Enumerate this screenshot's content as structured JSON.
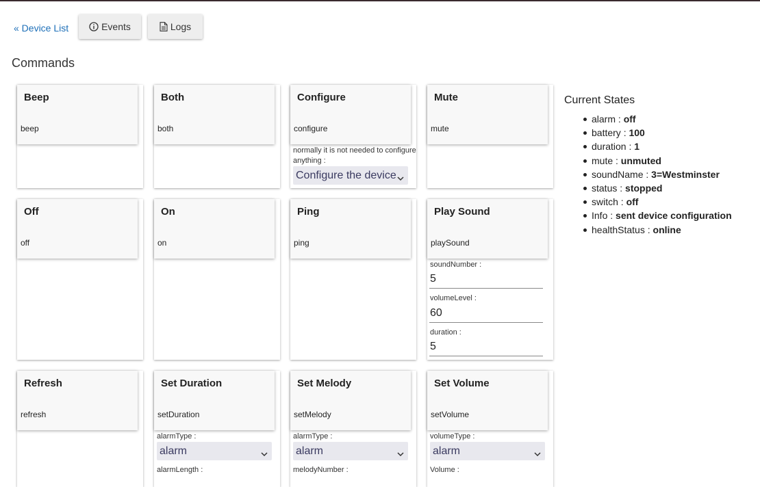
{
  "nav": {
    "back_link": "« Device List",
    "events_label": "Events",
    "logs_label": "Logs"
  },
  "commands_title": "Commands",
  "commands": {
    "beep": {
      "title": "Beep",
      "sub": "beep"
    },
    "both": {
      "title": "Both",
      "sub": "both"
    },
    "configure": {
      "title": "Configure",
      "sub": "configure",
      "param_label": "normally it is not needed to configure anything :",
      "param_value": "Configure the device"
    },
    "mute": {
      "title": "Mute",
      "sub": "mute"
    },
    "off": {
      "title": "Off",
      "sub": "off"
    },
    "on": {
      "title": "On",
      "sub": "on"
    },
    "ping": {
      "title": "Ping",
      "sub": "ping"
    },
    "play_sound": {
      "title": "Play Sound",
      "sub": "playSound",
      "params": [
        {
          "label": "soundNumber :",
          "value": "5"
        },
        {
          "label": "volumeLevel :",
          "value": "60"
        },
        {
          "label": "duration :",
          "value": "5"
        }
      ]
    },
    "refresh": {
      "title": "Refresh",
      "sub": "refresh"
    },
    "set_duration": {
      "title": "Set Duration",
      "sub": "setDuration",
      "param1_label": "alarmType :",
      "param1_value": "alarm",
      "param2_label": "alarmLength :"
    },
    "set_melody": {
      "title": "Set Melody",
      "sub": "setMelody",
      "param1_label": "alarmType :",
      "param1_value": "alarm",
      "param2_label": "melodyNumber :"
    },
    "set_volume": {
      "title": "Set Volume",
      "sub": "setVolume",
      "param1_label": "volumeType :",
      "param1_value": "alarm",
      "param2_label": "Volume :"
    }
  },
  "current_states": {
    "title": "Current States",
    "items": [
      {
        "name": "alarm",
        "value": "off"
      },
      {
        "name": "battery",
        "value": "100"
      },
      {
        "name": "duration",
        "value": "1"
      },
      {
        "name": "mute",
        "value": "unmuted"
      },
      {
        "name": "soundName",
        "value": "3=Westminster"
      },
      {
        "name": "status",
        "value": "stopped"
      },
      {
        "name": "switch",
        "value": "off"
      },
      {
        "name": "Info",
        "value": "sent device configuration"
      },
      {
        "name": "healthStatus",
        "value": "online"
      }
    ]
  },
  "icons": {
    "events": "info-circle-icon",
    "logs": "document-icon",
    "select": "chevron-down-icon"
  },
  "colors": {
    "link": "#1d6fb8",
    "select_bg": "#e8e8ee",
    "topbar": "#3a2a2e"
  }
}
